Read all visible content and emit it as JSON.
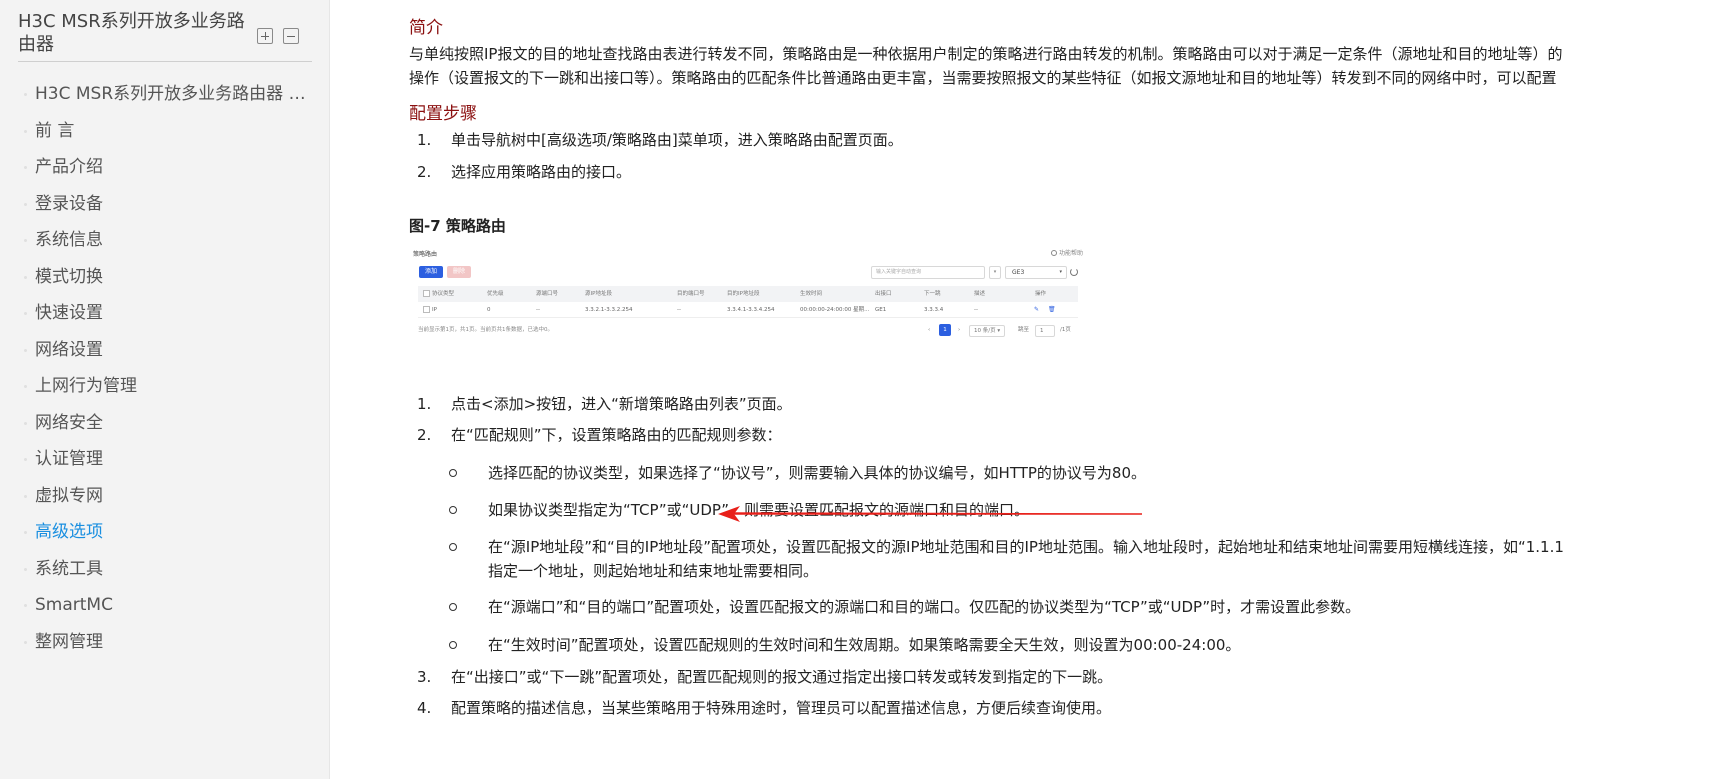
{
  "sidebar": {
    "title": "H3C MSR系列开放多业务路由器",
    "items": [
      {
        "label": "H3C MSR系列开放多业务路由器 W..."
      },
      {
        "label": "前 言"
      },
      {
        "label": "产品介绍"
      },
      {
        "label": "登录设备"
      },
      {
        "label": "系统信息"
      },
      {
        "label": "模式切换"
      },
      {
        "label": "快速设置"
      },
      {
        "label": "网络设置"
      },
      {
        "label": "上网行为管理"
      },
      {
        "label": "网络安全"
      },
      {
        "label": "认证管理"
      },
      {
        "label": "虚拟专网"
      },
      {
        "label": "高级选项",
        "active": true
      },
      {
        "label": "系统工具"
      },
      {
        "label": "SmartMC"
      },
      {
        "label": "整网管理"
      }
    ],
    "expand_icon": "plus-square-icon",
    "collapse_icon": "minus-square-icon"
  },
  "content": {
    "intro_heading": "简介",
    "intro_line1": "与单纯按照IP报文的目的地址查找路由表进行转发不同，策略路由是一种依据用户制定的策略进行路由转发的机制。策略路由可以对于满足一定条件（源地址和目的地址等）的",
    "intro_line2": "操作（设置报文的下一跳和出接口等）。策略路由的匹配条件比普通路由更丰富，当需要按照报文的某些特征（如报文源地址和目的地址等）转发到不同的网络中时，可以配置",
    "steps_heading": "配置步骤",
    "steps_a": [
      {
        "num": "1.",
        "text": "单击导航树中[高级选项/策略路由]菜单项，进入策略路由配置页面。"
      },
      {
        "num": "2.",
        "text": "选择应用策略路由的接口。"
      }
    ],
    "figure_caption": "图-7 策略路由",
    "steps_b": [
      {
        "num": "1.",
        "text": "点击<添加>按钮，进入“新增策略路由列表”页面。"
      },
      {
        "num": "2.",
        "text": "在“匹配规则”下，设置策略路由的匹配规则参数："
      }
    ],
    "sub_items": [
      {
        "text": "选择匹配的协议类型，如果选择了“协议号”，则需要输入具体的协议编号，如HTTP的协议号为80。"
      },
      {
        "text": "如果协议类型指定为“TCP”或“UDP”，则需要设置匹配报文的源端口和目的端口。"
      },
      {
        "text": "在“源IP地址段”和“目的IP地址段”配置项处，设置匹配报文的源IP地址范围和目的IP地址范围。输入地址段时，起始地址和结束地址间需要用短横线连接，如“1.1.1",
        "text2": "指定一个地址，则起始地址和结束地址需要相同。"
      },
      {
        "text": "在“源端口”和“目的端口”配置项处，设置匹配报文的源端口和目的端口。仅匹配的协议类型为“TCP”或“UDP”时，才需设置此参数。"
      },
      {
        "text": "在“生效时间”配置项处，设置匹配规则的生效时间和生效周期。如果策略需要全天生效，则设置为00:00-24:00。"
      }
    ],
    "steps_c": [
      {
        "num": "3.",
        "text": "在“出接口”或“下一跳”配置项处，配置匹配规则的报文通过指定出接口转发或转发到指定的下一跳。"
      },
      {
        "num": "4.",
        "text": "配置策略的描述信息，当某些策略用于特殊用途时，管理员可以配置描述信息，方便后续查询使用。"
      }
    ],
    "annotation_color": "#e8201a"
  },
  "figure": {
    "title": "策略路由",
    "help": "功能帮助",
    "add_label": "添加",
    "delete_label": "删除",
    "search_placeholder": "输入关键字自动查询",
    "dropdown1": "",
    "interface_value": "GE3",
    "columns": [
      "协议类型",
      "优先级",
      "源端口号",
      "源IP地址段",
      "目的端口号",
      "目的IP地址段",
      "生效时间",
      "出接口",
      "下一跳",
      "描述",
      "操作"
    ],
    "row": [
      "IP",
      "0",
      "--",
      "3.3.2.1-3.3.2.254",
      "--",
      "3.3.4.1-3.3.4.254",
      "00:00:00-24:00:00 星期...",
      "GE1",
      "3.3.3.4",
      "--"
    ],
    "footer": "当前显示第1页，共1页。当前页共1条数据，已选中0。",
    "pagination": {
      "prev": "‹",
      "current": "1",
      "next": "›",
      "page_size": "10 条/页",
      "goto_label": "跳至",
      "goto_value": "1",
      "total": "/1页"
    }
  }
}
